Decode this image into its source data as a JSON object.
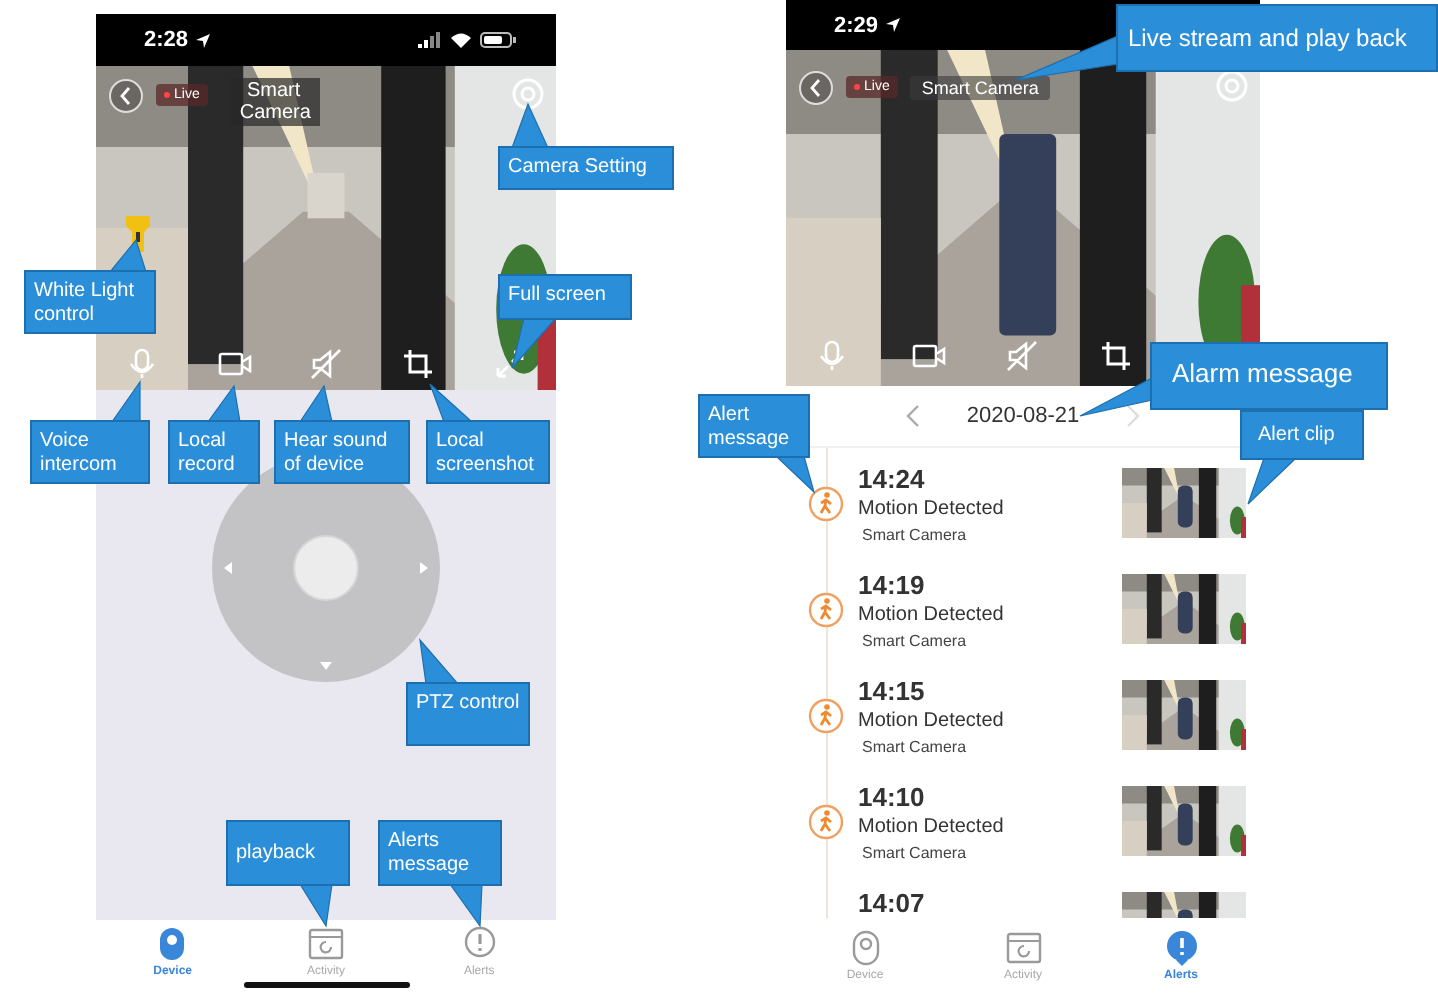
{
  "screens": [
    {
      "status_bar": {
        "time": "2:28"
      },
      "video": {
        "live_badge": "Live",
        "title": "Smart Camera"
      },
      "tab_bar": [
        {
          "label": "Device",
          "selected": true
        },
        {
          "label": "Activity",
          "selected": false
        },
        {
          "label": "Alerts",
          "selected": false
        }
      ]
    },
    {
      "status_bar": {
        "time": "2:29"
      },
      "video": {
        "live_badge": "Live",
        "title": "Smart Camera"
      },
      "date_nav": {
        "date": "2020-08-21"
      },
      "alerts": [
        {
          "time": "14:24",
          "event": "Motion Detected",
          "device": "Smart Camera"
        },
        {
          "time": "14:19",
          "event": "Motion Detected",
          "device": "Smart Camera"
        },
        {
          "time": "14:15",
          "event": "Motion Detected",
          "device": "Smart Camera"
        },
        {
          "time": "14:10",
          "event": "Motion Detected",
          "device": "Smart Camera"
        },
        {
          "time": "14:07"
        }
      ],
      "tab_bar": [
        {
          "label": "Device",
          "selected": false
        },
        {
          "label": "Activity",
          "selected": false
        },
        {
          "label": "Alerts",
          "selected": true
        }
      ]
    }
  ],
  "callouts": [
    {
      "text": "Camera Setting"
    },
    {
      "text": "White  Light control"
    },
    {
      "text": "Full screen"
    },
    {
      "text": "Voice intercom"
    },
    {
      "text": "Local record"
    },
    {
      "text": "Hear  sound of device"
    },
    {
      "text": "Local screenshot"
    },
    {
      "text": "PTZ control"
    },
    {
      "text": "playback"
    },
    {
      "text": "Alerts message"
    },
    {
      "text": "Live stream and play back"
    },
    {
      "text": "Alarm message"
    },
    {
      "text": "Alert message"
    },
    {
      "text": "Alert clip"
    }
  ]
}
